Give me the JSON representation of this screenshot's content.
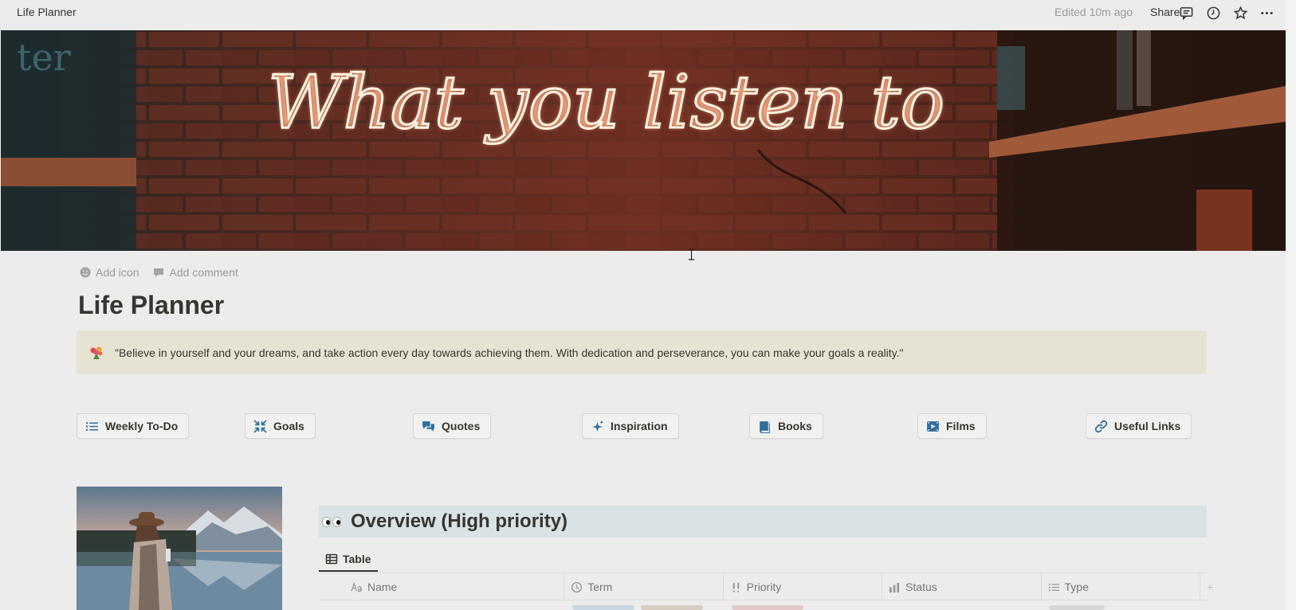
{
  "topbar": {
    "breadcrumb": "Life Planner",
    "edited": "Edited 10m ago",
    "share_label": "Share",
    "icons": [
      "comment-icon",
      "clock-history-icon",
      "star-icon",
      "more-icon"
    ]
  },
  "cover": {
    "neon_text": "What you listen to"
  },
  "page_meta": {
    "add_icon_label": "Add icon",
    "add_comment_label": "Add comment"
  },
  "title": "Life Planner",
  "callout": {
    "emoji": "flower-bouquet-icon",
    "text": "\"Believe in yourself and your dreams, and take action every day towards achieving them. With dedication and perseverance, you can make your goals a reality.\""
  },
  "links": [
    {
      "label": "Weekly To-Do",
      "icon": "list-icon"
    },
    {
      "label": "Goals",
      "icon": "compress-arrows-icon"
    },
    {
      "label": "Quotes",
      "icon": "chat-bubbles-icon"
    },
    {
      "label": "Inspiration",
      "icon": "sparkles-icon"
    },
    {
      "label": "Books",
      "icon": "book-icon"
    },
    {
      "label": "Films",
      "icon": "film-icon"
    },
    {
      "label": "Useful Links",
      "icon": "link-icon"
    }
  ],
  "overview": {
    "emoji": "eyes-icon",
    "title": "Overview (High priority)",
    "view_tab": "Table",
    "columns": [
      {
        "label": "Name",
        "icon": "text-aa-icon"
      },
      {
        "label": "Term",
        "icon": "clock-icon"
      },
      {
        "label": "Priority",
        "icon": "exclamation-icon"
      },
      {
        "label": "Status",
        "icon": "status-icon"
      },
      {
        "label": "Type",
        "icon": "list-icon"
      }
    ],
    "add_column": "+"
  },
  "colors": {
    "page_bg": "#ececec",
    "callout_bg": "#e6e3d3",
    "overview_bg": "#d9e2e4",
    "icon_blue": "#2f6f9f"
  }
}
